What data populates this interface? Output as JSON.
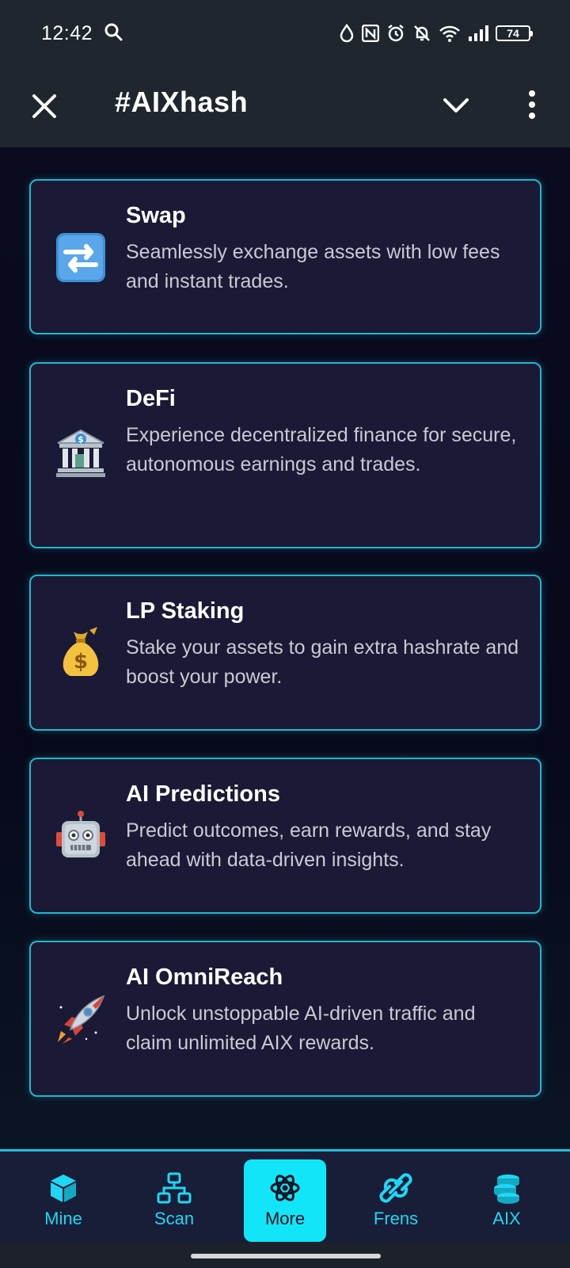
{
  "status_bar": {
    "time": "12:42",
    "battery": "74",
    "icons": [
      "search-icon",
      "water-drop-icon",
      "nfc-icon",
      "alarm-icon",
      "mute-icon",
      "wifi-icon",
      "signal-icon",
      "battery-icon"
    ]
  },
  "header": {
    "title": "#AIXhash",
    "icons": [
      "close-icon",
      "chevron-down-icon",
      "more-vertical-icon"
    ]
  },
  "cards": [
    {
      "title": "Swap",
      "description": "Seamlessly exchange assets with low fees and instant trades.",
      "icon": "swap-arrows-icon"
    },
    {
      "title": "DeFi",
      "description": "Experience decentralized finance for secure, autonomous earnings and trades.",
      "icon": "bank-icon"
    },
    {
      "title": "LP Staking",
      "description": "Stake your assets to gain extra hashrate and boost your power.",
      "icon": "money-bag-icon"
    },
    {
      "title": "AI Predictions",
      "description": "Predict outcomes, earn rewards, and stay ahead with data-driven insights.",
      "icon": "robot-icon"
    },
    {
      "title": "AI OmniReach",
      "description": "Unlock unstoppable AI-driven traffic and claim unlimited AIX rewards.",
      "icon": "rocket-icon"
    }
  ],
  "bottom_nav": {
    "active": "More",
    "items": [
      {
        "label": "Mine",
        "icon": "cube-icon"
      },
      {
        "label": "Scan",
        "icon": "network-icon"
      },
      {
        "label": "More",
        "icon": "atom-icon"
      },
      {
        "label": "Frens",
        "icon": "link-icon"
      },
      {
        "label": "AIX",
        "icon": "coins-icon"
      }
    ]
  },
  "colors": {
    "accent": "#1ed8f3",
    "card_border": "#21b7cc",
    "card_bg": "#1a1a36",
    "header_bg": "#1f262d",
    "page_bg": "#08091a"
  }
}
